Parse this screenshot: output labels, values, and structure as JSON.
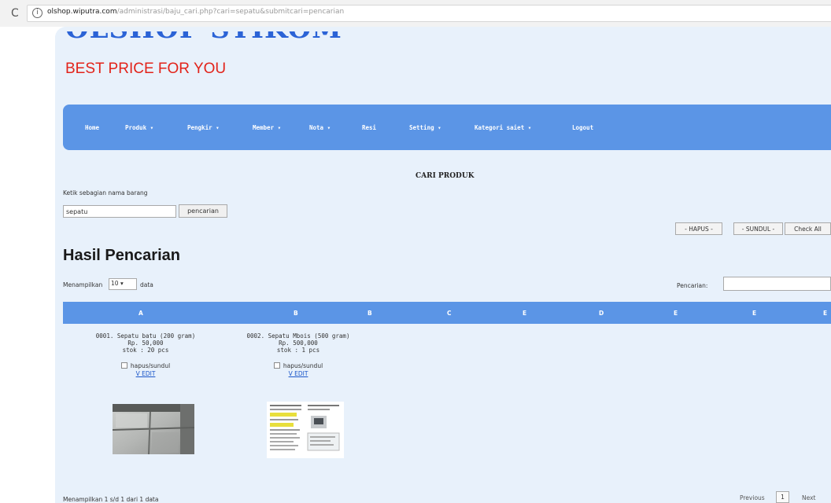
{
  "browser": {
    "reload_glyph": "C",
    "info_glyph": "i",
    "url_host": "olshop.wiputra.com",
    "url_path": "/administrasi/baju_cari.php?cari=sepatu&submitcari=pencarian"
  },
  "header": {
    "logo": "OLSHOP STIKOM",
    "tagline": "BEST PRICE FOR YOU"
  },
  "nav": {
    "items": [
      "Home",
      "Produk ▾",
      "Pengkir ▾",
      "Member ▾",
      "Nota ▾",
      "Resi",
      "Setting ▾",
      "Kategori saiet ▾",
      "Logout"
    ]
  },
  "search": {
    "title": "CARI PRODUK",
    "hint": "Ketik sebagian nama barang",
    "value": "sepatu",
    "button": "pencarian"
  },
  "actions": {
    "hapus": "- HAPUS -",
    "sundul": "- SUNDUL -",
    "check_all": "Check All"
  },
  "results": {
    "heading": "Hasil Pencarian",
    "show_label": "Menampilkan",
    "show_value": "10",
    "show_suffix": "data",
    "filter_label": "Pencarian:",
    "columns": [
      "A",
      "B",
      "B",
      "C",
      "E",
      "D",
      "E",
      "E",
      "E"
    ],
    "products": [
      {
        "name": "0001. Sepatu batu (200 gram)",
        "price": "Rp. 50,000",
        "stock": "stok : 20 pcs",
        "checkbox_label": "hapus/sundul",
        "edit": "V EDIT"
      },
      {
        "name": "0002. Sepatu Mbois (500 gram)",
        "price": "Rp. 500,000",
        "stock": "stok : 1 pcs",
        "checkbox_label": "hapus/sundul",
        "edit": "V EDIT"
      }
    ],
    "footer_info": "Menampilkan 1 s/d 1 dari 1 data",
    "pager": {
      "previous": "Previous",
      "current": "1",
      "next": "Next"
    }
  },
  "colors": {
    "brand_blue": "#5b95e6",
    "logo_blue": "#2b63d6",
    "tagline_red": "#e2231a",
    "page_bg": "#e8f1fb"
  }
}
